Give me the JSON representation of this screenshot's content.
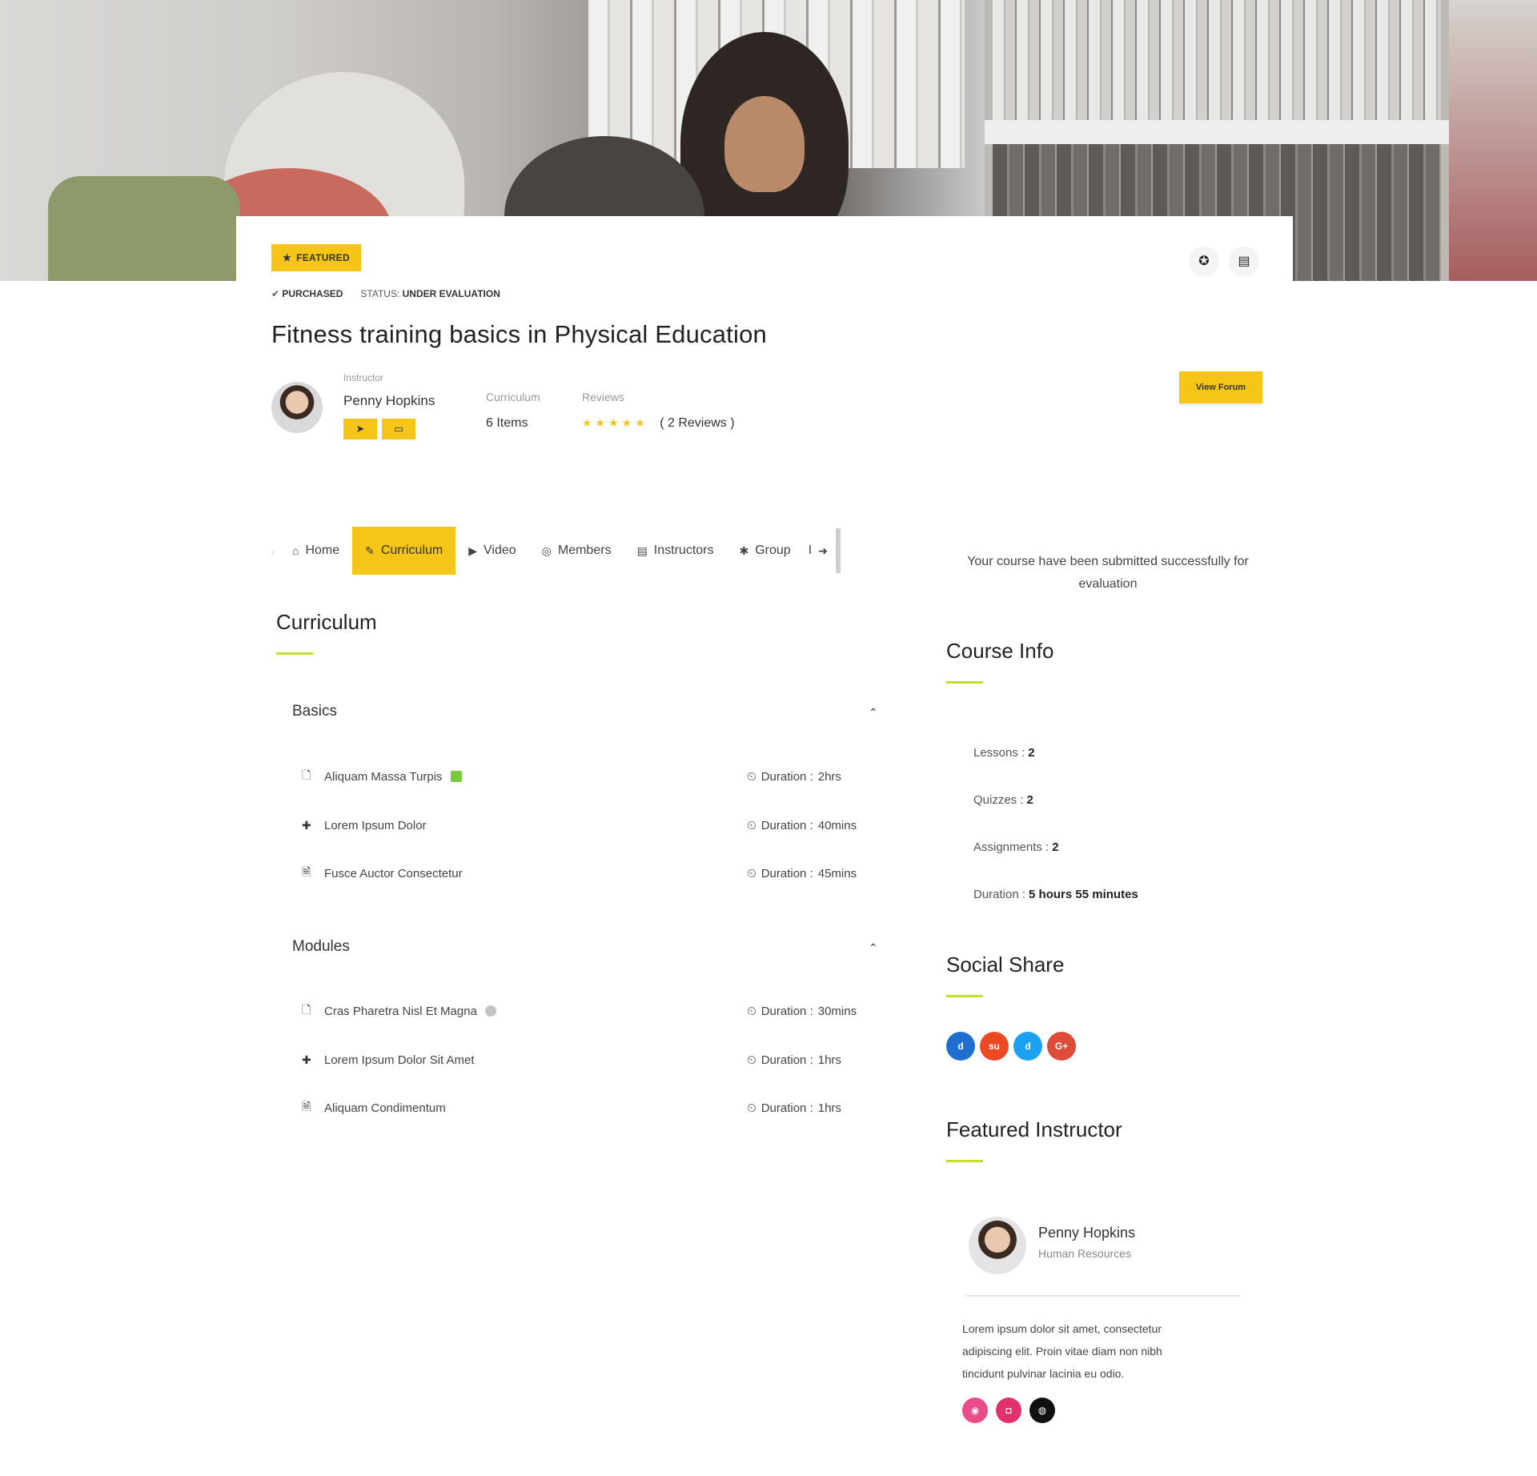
{
  "course": {
    "featured_badge": "FEATURED",
    "purchased": "PURCHASED",
    "status_label": "STATUS:",
    "status_value": "UNDER EVALUATION",
    "title": "Fitness training basics in Physical Education",
    "instructor_label": "Instructor",
    "instructor_name": "Penny Hopkins",
    "curriculum_label": "Curriculum",
    "curriculum_value": "6 Items",
    "reviews_label": "Reviews",
    "reviews_stars": "★★★★★",
    "reviews_count": "( 2 Reviews )",
    "rating": 5,
    "view_forum": "View Forum"
  },
  "tabs": [
    {
      "icon": "home-icon",
      "glyph": "⌂",
      "label": "Home"
    },
    {
      "icon": "book-icon",
      "glyph": "✎",
      "label": "Curriculum",
      "active": true
    },
    {
      "icon": "video-icon",
      "glyph": "▶",
      "label": "Video"
    },
    {
      "icon": "members-icon",
      "glyph": "◎",
      "label": "Members"
    },
    {
      "icon": "instructors-icon",
      "glyph": "▤",
      "label": "Instructors"
    },
    {
      "icon": "group-icon",
      "glyph": "✱",
      "label": "Group"
    },
    {
      "icon": "more-icon",
      "glyph": "➜",
      "label": "I"
    }
  ],
  "notice": "Your course have been submitted successfully for evaluation",
  "curriculum": {
    "heading": "Curriculum",
    "groups": [
      {
        "title": "Basics",
        "items": [
          {
            "icon": "file-icon",
            "glyph": "🗋",
            "name": "Aliquam Massa Turpis",
            "badge": "green",
            "duration_label": "Duration :",
            "duration": "2hrs"
          },
          {
            "icon": "puzzle-icon",
            "glyph": "✚",
            "name": "Lorem Ipsum Dolor",
            "duration_label": "Duration :",
            "duration": "40mins"
          },
          {
            "icon": "document-icon",
            "glyph": "🗎",
            "name": "Fusce Auctor Consectetur",
            "duration_label": "Duration :",
            "duration": "45mins"
          }
        ]
      },
      {
        "title": "Modules",
        "items": [
          {
            "icon": "file-icon",
            "glyph": "🗋",
            "name": "Cras Pharetra Nisl Et Magna",
            "badge": "grey",
            "duration_label": "Duration :",
            "duration": "30mins"
          },
          {
            "icon": "puzzle-icon",
            "glyph": "✚",
            "name": "Lorem Ipsum Dolor Sit Amet",
            "duration_label": "Duration :",
            "duration": "1hrs"
          },
          {
            "icon": "document-icon",
            "glyph": "🗎",
            "name": "Aliquam Condimentum",
            "duration_label": "Duration :",
            "duration": "1hrs"
          }
        ]
      }
    ]
  },
  "course_info": {
    "heading": "Course Info",
    "lessons_label": "Lessons :",
    "lessons": "2",
    "quizzes_label": "Quizzes :",
    "quizzes": "2",
    "assignments_label": "Assignments :",
    "assignments": "2",
    "duration_label": "Duration :",
    "duration": "5 hours 55 minutes"
  },
  "social_share": {
    "heading": "Social Share",
    "networks": [
      {
        "icon": "delicious-icon",
        "glyph": "d",
        "color": "#1f6fd1"
      },
      {
        "icon": "stumbleupon-icon",
        "glyph": "su",
        "color": "#eb4823"
      },
      {
        "icon": "digg-icon",
        "glyph": "d",
        "color": "#1da1f2"
      },
      {
        "icon": "google-plus-icon",
        "glyph": "G+",
        "color": "#dd4b39"
      }
    ]
  },
  "featured_instructor": {
    "heading": "Featured Instructor",
    "name": "Penny Hopkins",
    "title": "Human Resources",
    "bio": "Lorem ipsum dolor sit amet, consectetur adipiscing elit. Proin vitae diam non nibh tincidunt pulvinar lacinia eu odio.",
    "links": [
      {
        "icon": "dribbble-icon",
        "glyph": "◉",
        "color": "#ea4c89"
      },
      {
        "icon": "instagram-icon",
        "glyph": "◘",
        "color": "#e1306c"
      },
      {
        "icon": "github-icon",
        "glyph": "◍",
        "color": "#111111"
      }
    ]
  }
}
